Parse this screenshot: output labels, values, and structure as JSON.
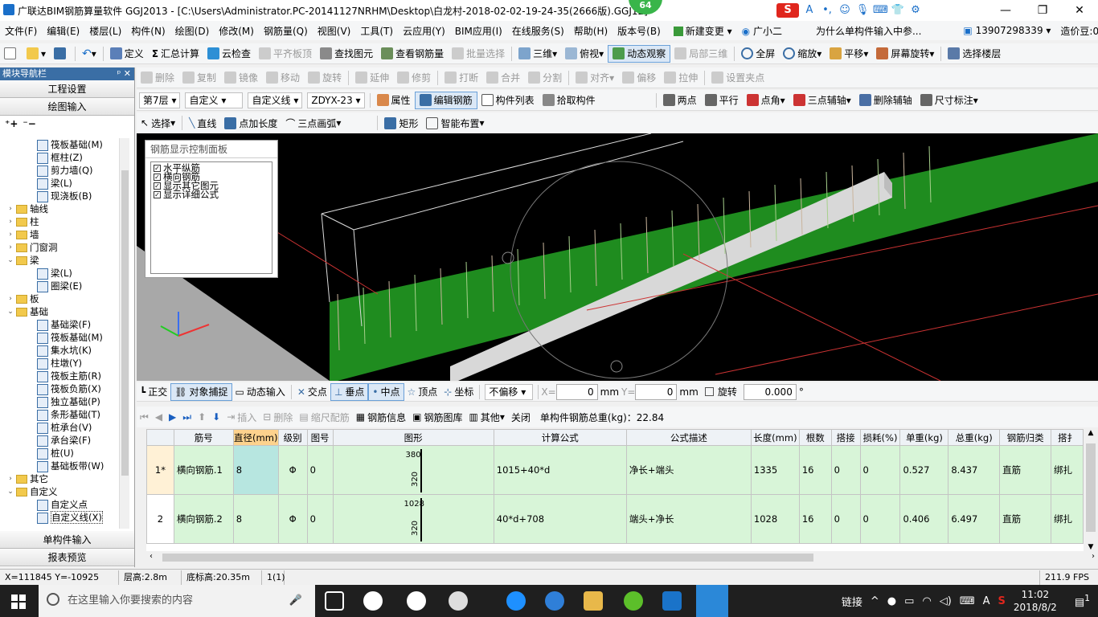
{
  "window": {
    "title": "广联达BIM钢筋算量软件 GGJ2013 - [C:\\Users\\Administrator.PC-20141127NRHM\\Desktop\\白龙村-2018-02-02-19-24-35(2666版).GGJ12]",
    "badge": "64",
    "buttons": [
      "—",
      "❐",
      "✕"
    ]
  },
  "ime": [
    "S",
    "A",
    "•,",
    "☺",
    "🎙",
    "⌨",
    "👕",
    "⚙"
  ],
  "menu": {
    "items": [
      "文件(F)",
      "编辑(E)",
      "楼层(L)",
      "构件(N)",
      "绘图(D)",
      "修改(M)",
      "钢筋量(Q)",
      "视图(V)",
      "工具(T)",
      "云应用(Y)",
      "BIM应用(I)",
      "在线服务(S)",
      "帮助(H)",
      "版本号(B)"
    ],
    "new_change": "新建变更",
    "assistant": "广小二",
    "question": "为什么单构件输入中参...",
    "phone": "13907298339",
    "price": "造价豆:0"
  },
  "toolbar1": {
    "items": [
      "定义",
      "汇总计算",
      "云检查",
      "平齐板顶",
      "查找图元",
      "查看钢筋量",
      "批量选择",
      "三维",
      "俯视",
      "动态观察",
      "局部三维",
      "全屏",
      "缩放",
      "平移",
      "屏幕旋转",
      "选择楼层"
    ]
  },
  "toolbar2": {
    "items": [
      "删除",
      "复制",
      "镜像",
      "移动",
      "旋转",
      "延伸",
      "修剪",
      "打断",
      "合并",
      "分割",
      "对齐",
      "偏移",
      "拉伸",
      "设置夹点"
    ]
  },
  "toolbar3": {
    "floor": "第7层",
    "type": "自定义",
    "subtype": "自定义线",
    "element": "ZDYX-23",
    "items": [
      "属性",
      "编辑钢筋",
      "构件列表",
      "拾取构件"
    ],
    "axis_items": [
      "两点",
      "平行",
      "点角",
      "三点辅轴",
      "删除辅轴",
      "尺寸标注"
    ]
  },
  "toolbar4": {
    "items": [
      "选择",
      "直线",
      "点加长度",
      "三点画弧",
      "矩形",
      "智能布置"
    ]
  },
  "nav": {
    "header": "模块导航栏",
    "pin": "ᵖ ✕",
    "btn_project": "工程设置",
    "btn_draw": "绘图输入",
    "btn_single": "单构件输入",
    "btn_report": "报表预览",
    "tree": [
      {
        "label": "筏板基础(M)",
        "lvl": 2,
        "kind": "item"
      },
      {
        "label": "框柱(Z)",
        "lvl": 2,
        "kind": "item"
      },
      {
        "label": "剪力墙(Q)",
        "lvl": 2,
        "kind": "item"
      },
      {
        "label": "梁(L)",
        "lvl": 2,
        "kind": "item"
      },
      {
        "label": "现浇板(B)",
        "lvl": 2,
        "kind": "item"
      },
      {
        "label": "轴线",
        "lvl": 1,
        "kind": "folder",
        "tw": "›"
      },
      {
        "label": "柱",
        "lvl": 1,
        "kind": "folder",
        "tw": "›"
      },
      {
        "label": "墙",
        "lvl": 1,
        "kind": "folder",
        "tw": "›"
      },
      {
        "label": "门窗洞",
        "lvl": 1,
        "kind": "folder",
        "tw": "›"
      },
      {
        "label": "梁",
        "lvl": 1,
        "kind": "folder",
        "tw": "⌄"
      },
      {
        "label": "梁(L)",
        "lvl": 2,
        "kind": "item"
      },
      {
        "label": "圈梁(E)",
        "lvl": 2,
        "kind": "item"
      },
      {
        "label": "板",
        "lvl": 1,
        "kind": "folder",
        "tw": "›"
      },
      {
        "label": "基础",
        "lvl": 1,
        "kind": "folder",
        "tw": "⌄"
      },
      {
        "label": "基础梁(F)",
        "lvl": 2,
        "kind": "item"
      },
      {
        "label": "筏板基础(M)",
        "lvl": 2,
        "kind": "item"
      },
      {
        "label": "集水坑(K)",
        "lvl": 2,
        "kind": "item"
      },
      {
        "label": "柱墩(Y)",
        "lvl": 2,
        "kind": "item"
      },
      {
        "label": "筏板主筋(R)",
        "lvl": 2,
        "kind": "item"
      },
      {
        "label": "筏板负筋(X)",
        "lvl": 2,
        "kind": "item"
      },
      {
        "label": "独立基础(P)",
        "lvl": 2,
        "kind": "item"
      },
      {
        "label": "条形基础(T)",
        "lvl": 2,
        "kind": "item"
      },
      {
        "label": "桩承台(V)",
        "lvl": 2,
        "kind": "item"
      },
      {
        "label": "承台梁(F)",
        "lvl": 2,
        "kind": "item"
      },
      {
        "label": "桩(U)",
        "lvl": 2,
        "kind": "item"
      },
      {
        "label": "基础板带(W)",
        "lvl": 2,
        "kind": "item"
      },
      {
        "label": "其它",
        "lvl": 1,
        "kind": "folder",
        "tw": "›"
      },
      {
        "label": "自定义",
        "lvl": 1,
        "kind": "folder",
        "tw": "⌄"
      },
      {
        "label": "自定义点",
        "lvl": 2,
        "kind": "item"
      },
      {
        "label": "自定义线(X)",
        "lvl": 2,
        "kind": "item",
        "selected": true
      }
    ]
  },
  "control_panel": {
    "title": "钢筋显示控制面板",
    "options": [
      "水平纵筋",
      "横向钢筋",
      "显示其它图元",
      "显示详细公式"
    ]
  },
  "snapbar": {
    "items": [
      "正交",
      "对象捕捉",
      "动态输入",
      "交点",
      "垂点",
      "中点",
      "顶点",
      "坐标"
    ],
    "offset": "不偏移",
    "x_label": "X=",
    "x_value": "0",
    "y_label": "Y=",
    "y_value": "0",
    "unit": "mm",
    "rotate_label": "旋转",
    "rotate_value": "0.000",
    "degree": "°"
  },
  "rebarbar": {
    "items": [
      "插入",
      "删除",
      "缩尺配筋",
      "钢筋信息",
      "钢筋图库",
      "其他",
      "关闭"
    ],
    "total_label": "单构件钢筋总重(kg)：22.84"
  },
  "grid": {
    "columns": [
      "筋号",
      "直径(mm)",
      "级别",
      "图号",
      "图形",
      "计算公式",
      "公式描述",
      "长度(mm)",
      "根数",
      "搭接",
      "损耗(%)",
      "单重(kg)",
      "总重(kg)",
      "钢筋归类",
      "搭扌"
    ],
    "rows": [
      {
        "no": "1*",
        "name": "横向钢筋.1",
        "dia": "8",
        "grade": "Φ",
        "fig": "0",
        "shape_top": "380",
        "shape_side": "320",
        "formula": "1015+40*d",
        "desc": "净长+端头",
        "len": "1335",
        "count": "16",
        "lap": "0",
        "loss": "0",
        "unit_w": "0.527",
        "total_w": "8.437",
        "cls": "直筋",
        "bind": "绑扎"
      },
      {
        "no": "2",
        "name": "横向钢筋.2",
        "dia": "8",
        "grade": "Φ",
        "fig": "0",
        "shape_top": "1028",
        "shape_side": "320",
        "formula": "40*d+708",
        "desc": "端头+净长",
        "len": "1028",
        "count": "16",
        "lap": "0",
        "loss": "0",
        "unit_w": "0.406",
        "total_w": "6.497",
        "cls": "直筋",
        "bind": "绑扎"
      }
    ]
  },
  "status": {
    "coords": "X=111845 Y=-10925",
    "floor_height": "层高:2.8m",
    "bottom_height": "底标高:20.35m",
    "count": "1(1)",
    "fps": "211.9 FPS"
  },
  "taskbar": {
    "search_placeholder": "在这里输入你要搜索的内容",
    "link": "链接",
    "ime_lang": "A",
    "time": "11:02",
    "date": "2018/8/2",
    "notif": "1"
  }
}
